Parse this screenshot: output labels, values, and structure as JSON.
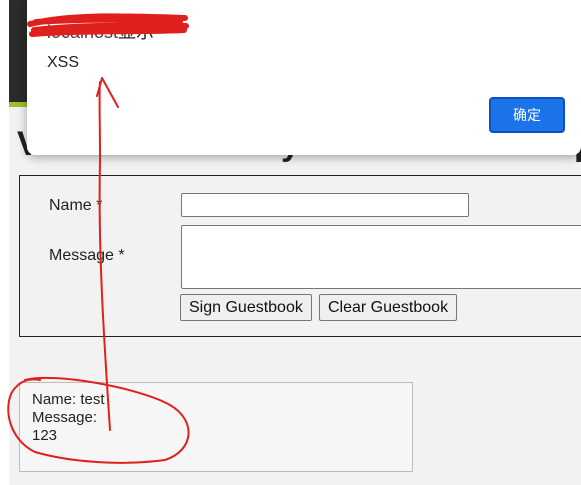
{
  "page": {
    "heading_fragment_left": "V",
    "heading_fragment_middle": "y",
    "heading_fragment_right": "p"
  },
  "form": {
    "name_label": "Name *",
    "message_label": "Message *",
    "name_value": "",
    "message_value": "",
    "sign_button": "Sign Guestbook",
    "clear_button": "Clear Guestbook"
  },
  "entry": {
    "name_line": "Name: test",
    "message_line": "Message:",
    "message_value": "123"
  },
  "dialog": {
    "title_origin": "localhost",
    "title_suffix": "显示",
    "message": "XSS",
    "ok_label": "确定"
  },
  "colors": {
    "accent": "#1a73e8",
    "annotation": "#e0201c",
    "green_strip": "#9bc128"
  }
}
